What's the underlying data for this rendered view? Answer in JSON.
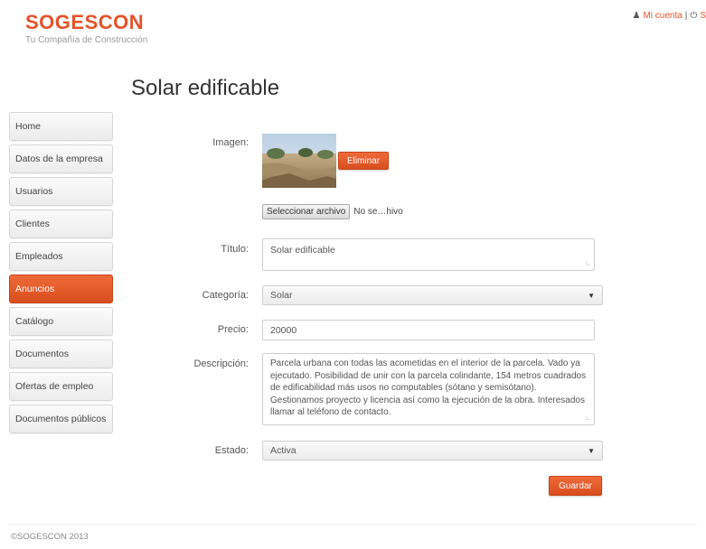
{
  "brand": {
    "name": "SOGESCON",
    "tagline": "Tu Compañía de Construcción"
  },
  "topnav": {
    "account": "Mi cuenta",
    "separator": "|",
    "logout": "S"
  },
  "page": {
    "title": "Solar edificable"
  },
  "sidebar": {
    "items": [
      {
        "label": "Home",
        "active": false
      },
      {
        "label": "Datos de la empresa",
        "active": false
      },
      {
        "label": "Usuarios",
        "active": false
      },
      {
        "label": "Clientes",
        "active": false
      },
      {
        "label": "Empleados",
        "active": false
      },
      {
        "label": "Anuncios",
        "active": true
      },
      {
        "label": "Catálogo",
        "active": false
      },
      {
        "label": "Documentos",
        "active": false
      },
      {
        "label": "Ofertas de empleo",
        "active": false
      },
      {
        "label": "Documentos públicos",
        "active": false
      }
    ]
  },
  "form": {
    "image_label": "Imagen:",
    "delete_label": "Eliminar",
    "file_button": "Seleccionar archivo",
    "file_status": "No se…hivo",
    "title_label": "Título:",
    "title_value": "Solar edificable",
    "category_label": "Categoría:",
    "category_value": "Solar",
    "price_label": "Precio:",
    "price_value": "20000",
    "description_label": "Descripción:",
    "description_value": "Parcela urbana con todas las acometidas en el interior de la parcela. Vado ya ejecutado. Posibilidad de unir con la parcela colindante, 154 metros cuadrados de edificabilidad más usos no computables (sótano y semisótano). Gestionamos proyecto y licencia así como la ejecución de la obra. Interesados llamar al teléfono de contacto.",
    "status_label": "Estado:",
    "status_value": "Activa",
    "save_label": "Guardar"
  },
  "footer": {
    "text": "©SOGESCON 2013"
  },
  "colors": {
    "accent": "#e3532a"
  }
}
